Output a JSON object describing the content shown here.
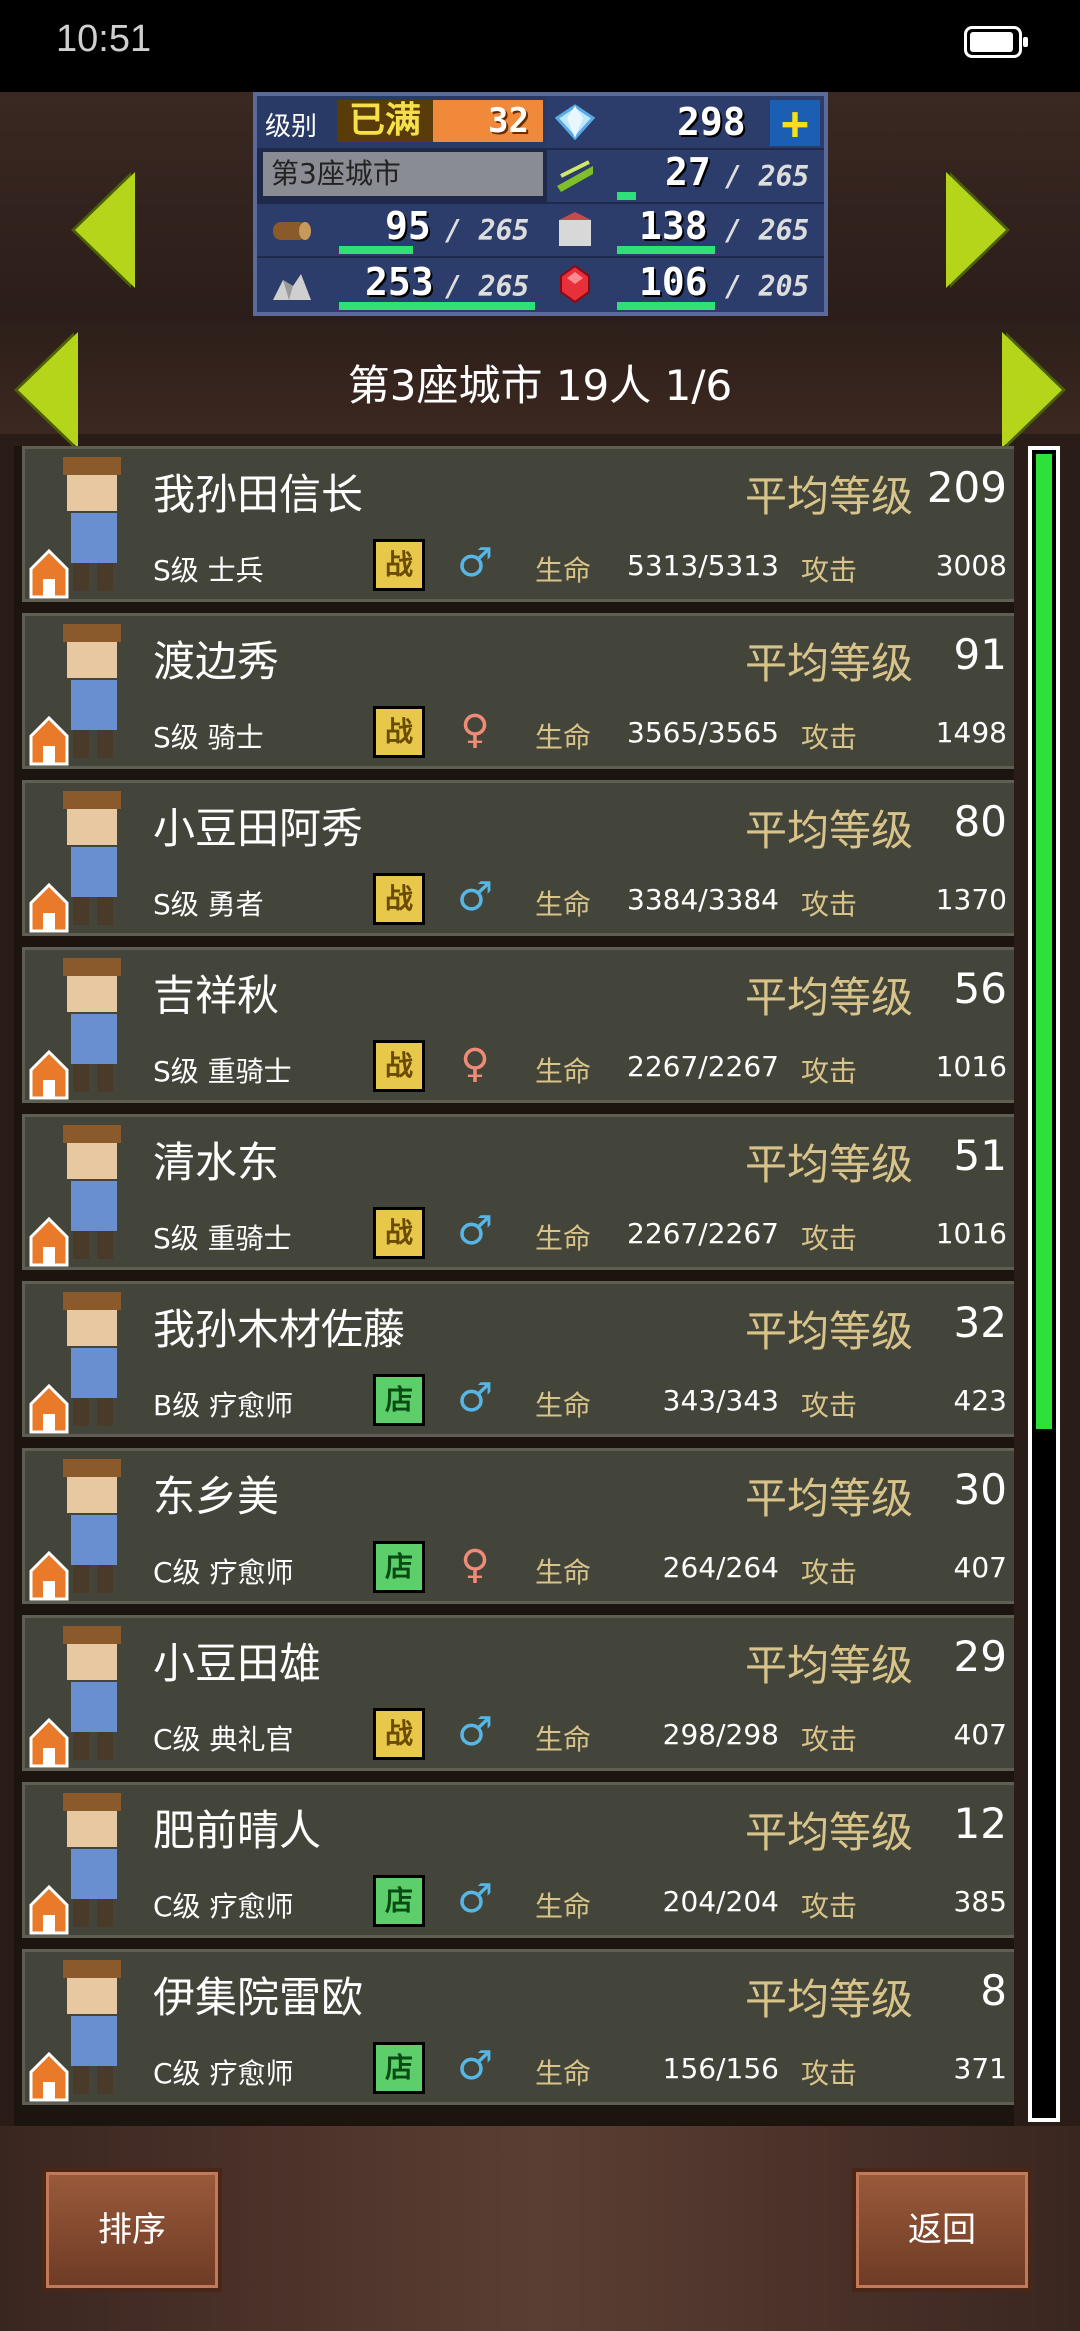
{
  "status": {
    "time": "10:51"
  },
  "stats": {
    "level_label": "级别",
    "level_full": "已满",
    "level_value": "32",
    "city_name": "第3座城市",
    "gems": "298",
    "food": {
      "value": "27",
      "max": "/ 265",
      "fill": 0.1
    },
    "wood": {
      "value": "95",
      "max": "/ 265",
      "fill": 0.36
    },
    "merch": {
      "value": "138",
      "max": "/ 265",
      "fill": 0.52
    },
    "ore": {
      "value": "253",
      "max": "/ 265",
      "fill": 0.95
    },
    "ruby": {
      "value": "106",
      "max": "/ 205",
      "fill": 0.52
    }
  },
  "title": "第3座城市  19人 1/6",
  "labels": {
    "avg": "平均等级",
    "hp": "生命",
    "atk": "攻击"
  },
  "residents": [
    {
      "name": "我孙田信长",
      "avg": "209",
      "cls": "S级 士兵",
      "badge": "战",
      "badge_type": "fight",
      "gender": "♂",
      "gender_type": "m",
      "hp": "5313/5313",
      "atk": "3008"
    },
    {
      "name": "渡边秀",
      "avg": "91",
      "cls": "S级 骑士",
      "badge": "战",
      "badge_type": "fight",
      "gender": "♀",
      "gender_type": "f",
      "hp": "3565/3565",
      "atk": "1498"
    },
    {
      "name": "小豆田阿秀",
      "avg": "80",
      "cls": "S级 勇者",
      "badge": "战",
      "badge_type": "fight",
      "gender": "♂",
      "gender_type": "m",
      "hp": "3384/3384",
      "atk": "1370"
    },
    {
      "name": "吉祥秋",
      "avg": "56",
      "cls": "S级 重骑士",
      "badge": "战",
      "badge_type": "fight",
      "gender": "♀",
      "gender_type": "f",
      "hp": "2267/2267",
      "atk": "1016"
    },
    {
      "name": "清水东",
      "avg": "51",
      "cls": "S级 重骑士",
      "badge": "战",
      "badge_type": "fight",
      "gender": "♂",
      "gender_type": "m",
      "hp": "2267/2267",
      "atk": "1016"
    },
    {
      "name": "我孙木材佐藤",
      "avg": "32",
      "cls": "B级 疗愈师",
      "badge": "店",
      "badge_type": "shop",
      "gender": "♂",
      "gender_type": "m",
      "hp": "343/343",
      "atk": "423"
    },
    {
      "name": "东乡美",
      "avg": "30",
      "cls": "C级 疗愈师",
      "badge": "店",
      "badge_type": "shop",
      "gender": "♀",
      "gender_type": "f",
      "hp": "264/264",
      "atk": "407"
    },
    {
      "name": "小豆田雄",
      "avg": "29",
      "cls": "C级 典礼官",
      "badge": "战",
      "badge_type": "fight",
      "gender": "♂",
      "gender_type": "m",
      "hp": "298/298",
      "atk": "407"
    },
    {
      "name": "肥前晴人",
      "avg": "12",
      "cls": "C级 疗愈师",
      "badge": "店",
      "badge_type": "shop",
      "gender": "♂",
      "gender_type": "m",
      "hp": "204/204",
      "atk": "385"
    },
    {
      "name": "伊集院雷欧",
      "avg": "8",
      "cls": "C级 疗愈师",
      "badge": "店",
      "badge_type": "shop",
      "gender": "♂",
      "gender_type": "m",
      "hp": "156/156",
      "atk": "371"
    }
  ],
  "buttons": {
    "sort": "排序",
    "back": "返回"
  },
  "colors": {
    "accent": "#b5d51a",
    "bar": "#2fe07a",
    "scroll": "#2ce23a"
  }
}
